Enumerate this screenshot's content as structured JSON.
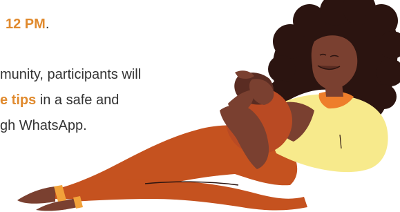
{
  "text": {
    "line1_time": "12 PM",
    "line1_end": ".",
    "line2": "munity, participants will",
    "line3_em": "e tips",
    "line3_rest": " in a safe and",
    "line4": "gh WhatsApp."
  },
  "colors": {
    "accent": "#e08a2e",
    "text": "#333333",
    "hair": "#2b1410",
    "skin": "#7a4030",
    "skin_dark": "#5a2c22",
    "baby": "#b94a23",
    "pants": "#c5521f",
    "top": "#f7ea8c",
    "collar": "#ee7e2b"
  },
  "illustration": {
    "subject": "woman-breastfeeding-baby-illustration"
  }
}
